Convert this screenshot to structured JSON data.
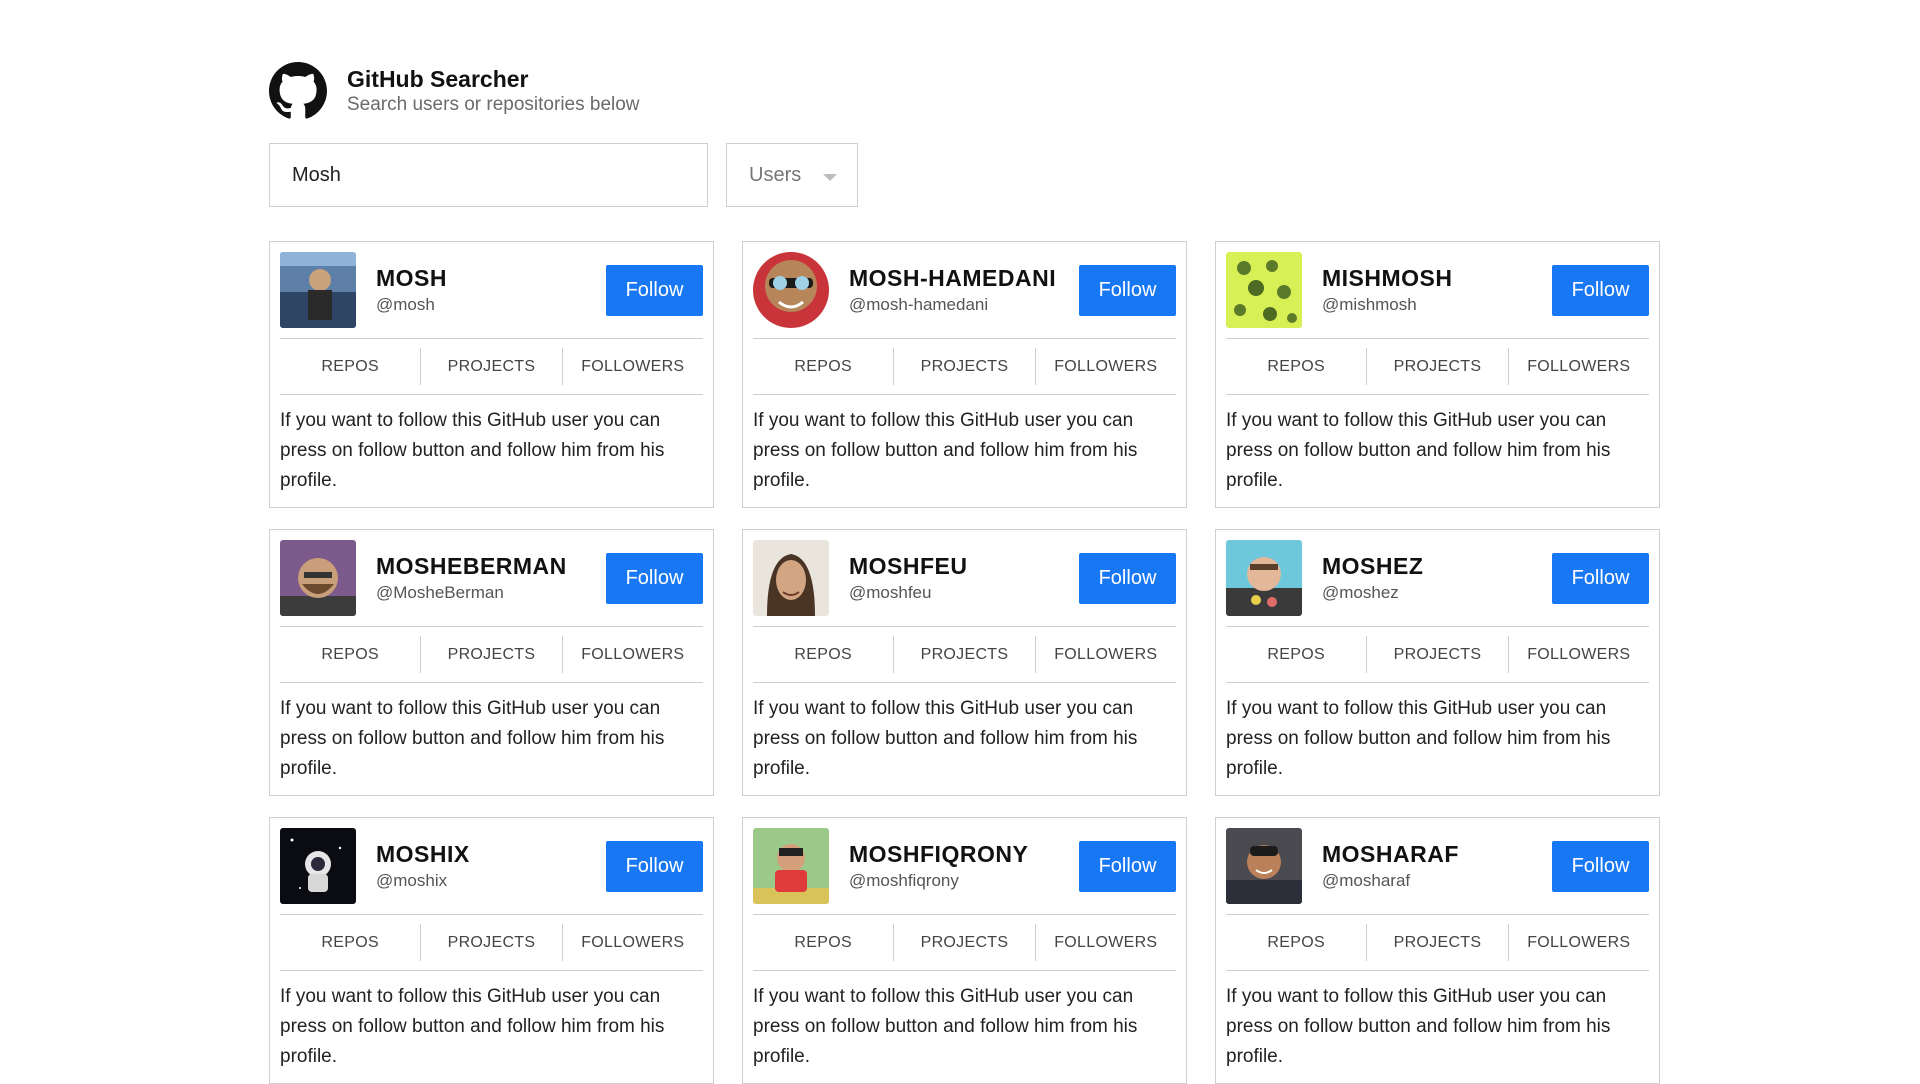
{
  "app": {
    "title": "GitHub Searcher",
    "subtitle": "Search users or repositories below",
    "logo_icon": "github-octocat-icon"
  },
  "search": {
    "query": "Mosh",
    "type_selected": "Users"
  },
  "colors": {
    "follow_button": "#1877f2",
    "border": "#cfcfcf"
  },
  "stat_labels": [
    "REPOS",
    "PROJECTS",
    "FOLLOWERS"
  ],
  "follow_label": "Follow",
  "description": "If you want to follow this GitHub user you can press on follow button and follow him from his profile.",
  "users": [
    {
      "name": "MOSH",
      "handle": "@mosh"
    },
    {
      "name": "MOSH-HAMEDANI",
      "handle": "@mosh-hamedani"
    },
    {
      "name": "MISHMOSH",
      "handle": "@mishmosh"
    },
    {
      "name": "MOSHEBERMAN",
      "handle": "@MosheBerman"
    },
    {
      "name": "MOSHFEU",
      "handle": "@moshfeu"
    },
    {
      "name": "MOSHEZ",
      "handle": "@moshez"
    },
    {
      "name": "MOSHIX",
      "handle": "@moshix"
    },
    {
      "name": "MOSHFIQRONY",
      "handle": "@moshfiqrony"
    },
    {
      "name": "MOSHARAF",
      "handle": "@mosharaf"
    }
  ]
}
